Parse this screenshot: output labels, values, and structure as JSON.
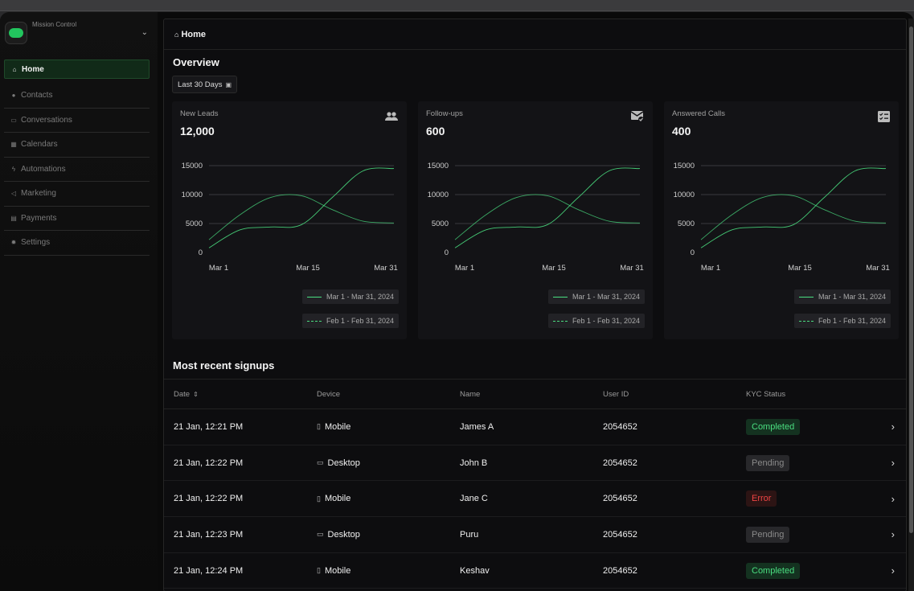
{
  "workspace": {
    "name": "Mission Control"
  },
  "sidebar": {
    "items": [
      {
        "label": "Home",
        "icon": "home-icon",
        "glyph": "⌂",
        "active": true
      },
      {
        "label": "Contacts",
        "icon": "contacts-icon",
        "glyph": "●",
        "active": false
      },
      {
        "label": "Conversations",
        "icon": "chat-icon",
        "glyph": "▭",
        "active": false
      },
      {
        "label": "Calendars",
        "icon": "calendar-icon",
        "glyph": "▦",
        "active": false
      },
      {
        "label": "Automations",
        "icon": "bolt-icon",
        "glyph": "ϟ",
        "active": false
      },
      {
        "label": "Marketing",
        "icon": "megaphone-icon",
        "glyph": "◁",
        "active": false
      },
      {
        "label": "Payments",
        "icon": "receipt-icon",
        "glyph": "▤",
        "active": false
      },
      {
        "label": "Settings",
        "icon": "gear-icon",
        "glyph": "✹",
        "active": false
      }
    ]
  },
  "breadcrumb": {
    "label": "Home"
  },
  "overview": {
    "title": "Overview",
    "date_range": "Last 30 Days"
  },
  "cards": [
    {
      "label": "New Leads",
      "value": "12,000",
      "icon": "users-icon"
    },
    {
      "label": "Follow-ups",
      "value": "600",
      "icon": "mail-check-icon"
    },
    {
      "label": "Answered Calls",
      "value": "400",
      "icon": "checklist-icon"
    }
  ],
  "chart_data": [
    {
      "type": "line",
      "x": [
        "Mar 1",
        "Mar 15",
        "Mar 31"
      ],
      "yticks": [
        0,
        5000,
        10000,
        15000
      ],
      "ylim": [
        0,
        15000
      ],
      "grid": true,
      "legend_placement": "bottom-right",
      "series": [
        {
          "name": "Mar 1 - Mar 31, 2024",
          "style": "solid",
          "values": [
            800,
            3900,
            4400,
            4800,
            9500,
            14100,
            14500
          ]
        },
        {
          "name": "Feb 1 - Feb 31, 2024",
          "style": "dashed",
          "values": [
            2200,
            6500,
            9500,
            9800,
            7400,
            5400,
            5100
          ]
        }
      ]
    },
    {
      "type": "line",
      "x": [
        "Mar 1",
        "Mar 15",
        "Mar 31"
      ],
      "yticks": [
        0,
        5000,
        10000,
        15000
      ],
      "ylim": [
        0,
        15000
      ],
      "grid": true,
      "legend_placement": "bottom-right",
      "series": [
        {
          "name": "Mar 1 - Mar 31, 2024",
          "style": "solid",
          "values": [
            800,
            3900,
            4400,
            4800,
            9500,
            14100,
            14500
          ]
        },
        {
          "name": "Feb 1 - Feb 31, 2024",
          "style": "dashed",
          "values": [
            2200,
            6500,
            9500,
            9800,
            7400,
            5400,
            5100
          ]
        }
      ]
    },
    {
      "type": "line",
      "x": [
        "Mar 1",
        "Mar 15",
        "Mar 31"
      ],
      "yticks": [
        0,
        5000,
        10000,
        15000
      ],
      "ylim": [
        0,
        15000
      ],
      "grid": true,
      "legend_placement": "bottom-right",
      "series": [
        {
          "name": "Mar 1 - Mar 31, 2024",
          "style": "solid",
          "values": [
            800,
            3900,
            4400,
            4800,
            9500,
            14100,
            14500
          ]
        },
        {
          "name": "Feb 1 - Feb 31, 2024",
          "style": "dashed",
          "values": [
            2200,
            6500,
            9500,
            9800,
            7400,
            5400,
            5100
          ]
        }
      ]
    }
  ],
  "signups": {
    "title": "Most recent signups",
    "columns": [
      "Date",
      "Device",
      "Name",
      "User ID",
      "KYC Status"
    ],
    "rows": [
      {
        "date": "21 Jan, 12:21 PM",
        "device": "Mobile",
        "name": "James A",
        "user_id": "2054652",
        "status": "Completed"
      },
      {
        "date": "21 Jan, 12:22 PM",
        "device": "Desktop",
        "name": "John B",
        "user_id": "2054652",
        "status": "Pending"
      },
      {
        "date": "21 Jan, 12:22 PM",
        "device": "Mobile",
        "name": "Jane C",
        "user_id": "2054652",
        "status": "Error"
      },
      {
        "date": "21 Jan, 12:23 PM",
        "device": "Desktop",
        "name": "Puru",
        "user_id": "2054652",
        "status": "Pending"
      },
      {
        "date": "21 Jan, 12:24 PM",
        "device": "Mobile",
        "name": "Keshav",
        "user_id": "2054652",
        "status": "Completed"
      }
    ]
  },
  "colors": {
    "accent": "#4ade80",
    "success": "#4ade80",
    "error": "#ef4444",
    "pending": "#8a8a8a"
  }
}
